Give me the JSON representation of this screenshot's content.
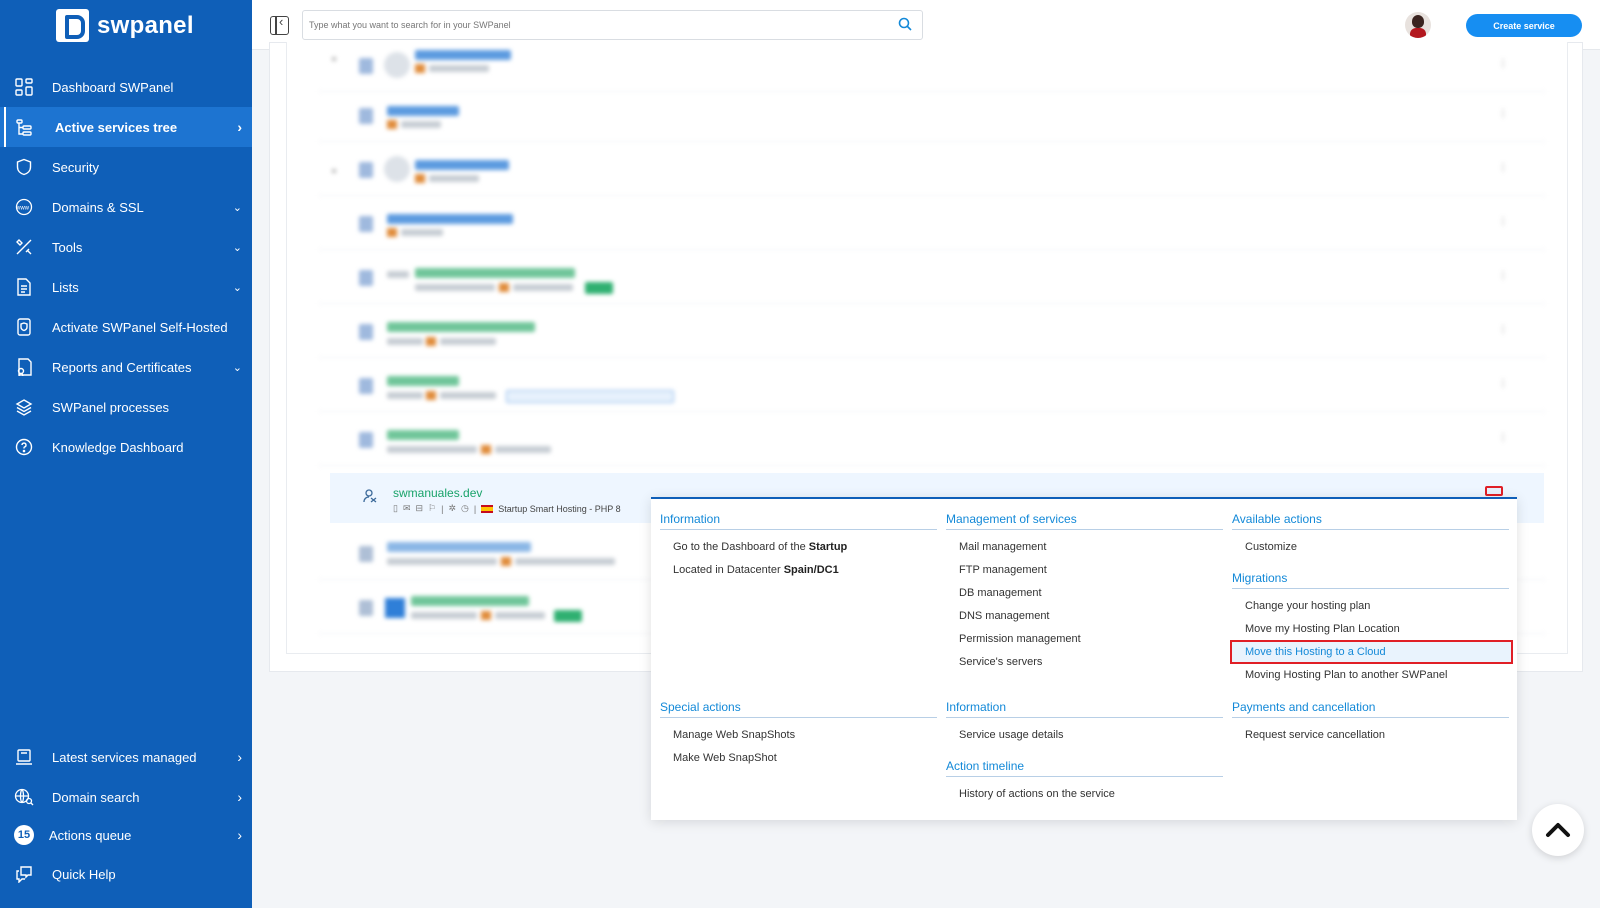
{
  "sidebar": {
    "brand": "swpanel",
    "items": [
      {
        "label": "Dashboard SWPanel"
      },
      {
        "label": "Active services tree"
      },
      {
        "label": "Security"
      },
      {
        "label": "Domains & SSL"
      },
      {
        "label": "Tools"
      },
      {
        "label": "Lists"
      },
      {
        "label": "Activate SWPanel Self-Hosted"
      },
      {
        "label": "Reports and Certificates"
      },
      {
        "label": "SWPanel processes"
      },
      {
        "label": "Knowledge Dashboard"
      }
    ],
    "bottom": [
      {
        "label": "Latest services managed"
      },
      {
        "label": "Domain search"
      },
      {
        "label": "Actions queue",
        "badge": "15"
      },
      {
        "label": "Quick Help"
      }
    ]
  },
  "topbar": {
    "search_placeholder": "Type what you want to search for in your SWPanel",
    "create_label": "Create service"
  },
  "service": {
    "name": "swmanuales.dev",
    "plan": "Startup Smart Hosting - PHP 8"
  },
  "menu": {
    "info_title": "Information",
    "info_items": [
      {
        "prefix": "Go to the Dashboard of the ",
        "bold": "Startup"
      },
      {
        "prefix": "Located in Datacenter ",
        "bold": "Spain/DC1"
      }
    ],
    "special_title": "Special actions",
    "special_items": [
      "Manage Web SnapShots",
      "Make Web SnapShot"
    ],
    "mgmt_title": "Management of services",
    "mgmt_items": [
      "Mail management",
      "FTP management",
      "DB management",
      "DNS management",
      "Permission management",
      "Service's servers"
    ],
    "info2_title": "Information",
    "info2_items": [
      "Service usage details"
    ],
    "timeline_title": "Action timeline",
    "timeline_items": [
      "History of actions on the service"
    ],
    "actions_title": "Available actions",
    "actions_items": [
      "Customize"
    ],
    "migrations_title": "Migrations",
    "migrations_items": [
      "Change your hosting plan",
      "Move my Hosting Plan Location",
      "Move this Hosting to a Cloud",
      "Moving Hosting Plan to another SWPanel"
    ],
    "payments_title": "Payments and cancellation",
    "payments_items": [
      "Request service cancellation"
    ]
  },
  "colors": {
    "sidebar": "#0f5fb8",
    "accent": "#1389d8",
    "highlight_border": "#e01f26",
    "create_button": "#168ef2"
  }
}
